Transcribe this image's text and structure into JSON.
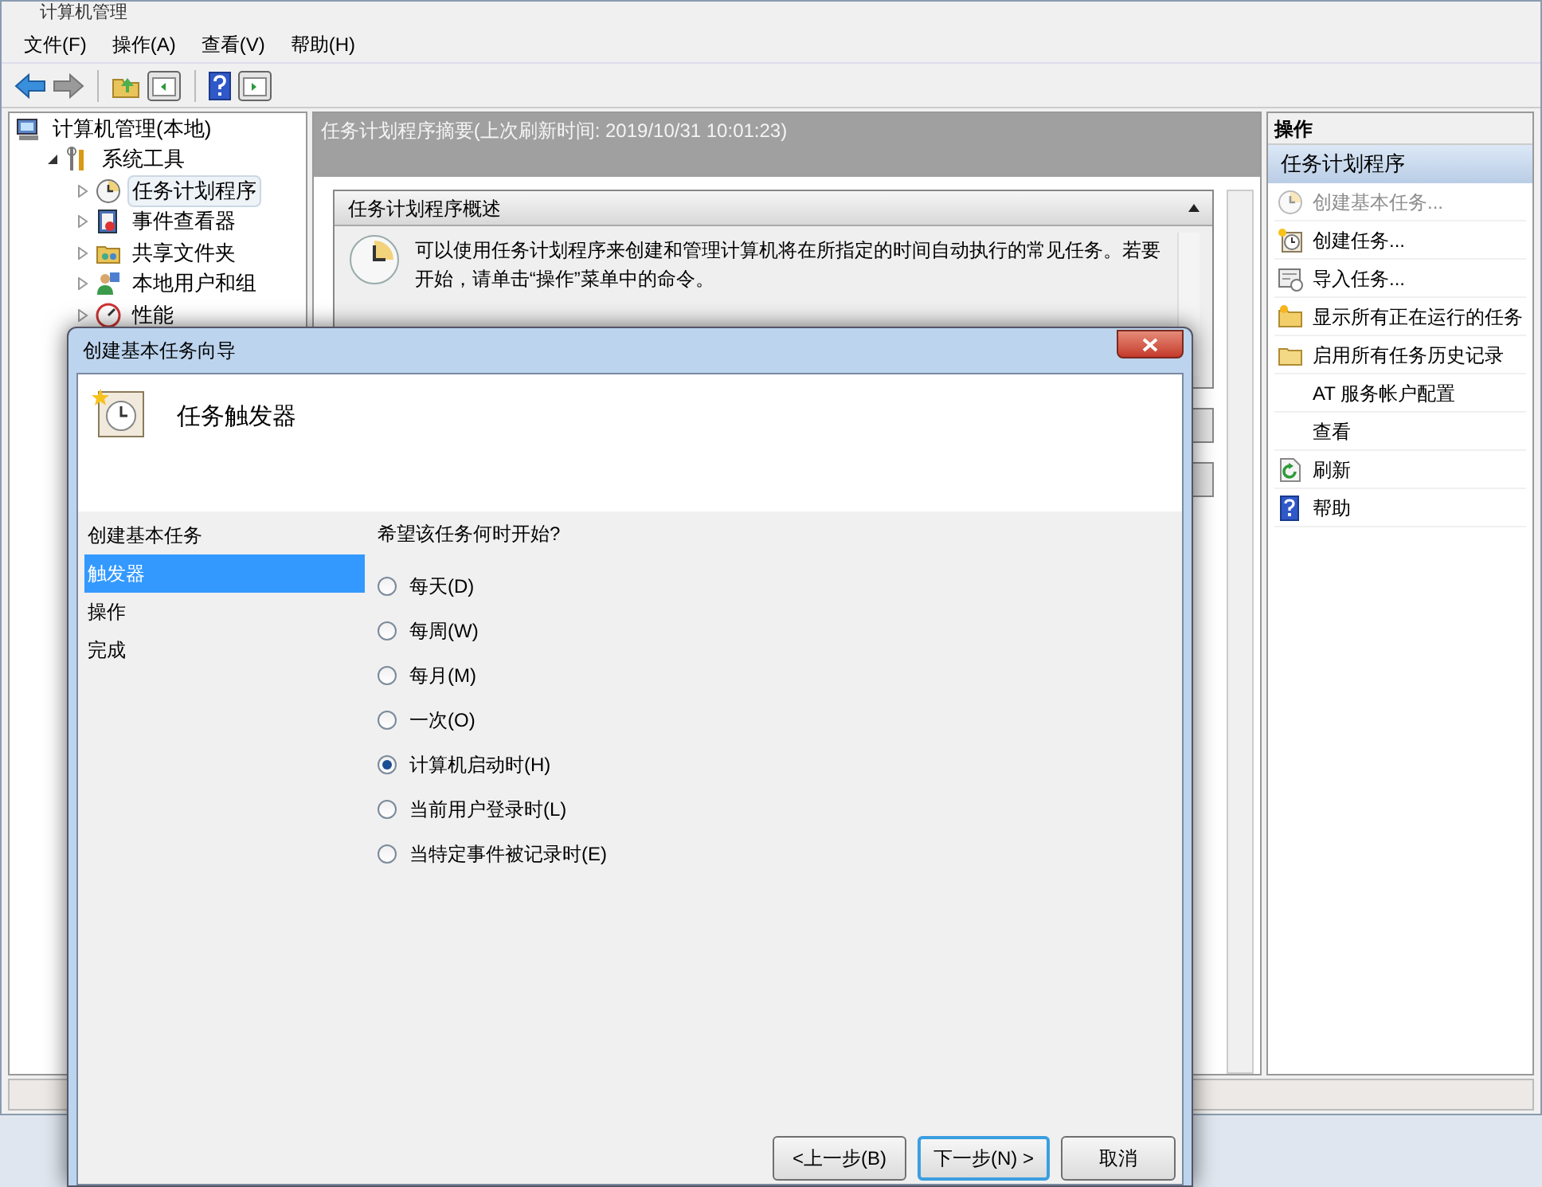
{
  "window": {
    "title": "计算机管理"
  },
  "menu": [
    "文件(F)",
    "操作(A)",
    "查看(V)",
    "帮助(H)"
  ],
  "tree": [
    {
      "label": "计算机管理(本地)",
      "children": [
        {
          "label": "系统工具",
          "expanded": true,
          "children": [
            {
              "label": "任务计划程序",
              "expanded": false,
              "selected": true
            },
            {
              "label": "事件查看器",
              "expanded": false,
              "selected": false
            },
            {
              "label": "共享文件夹",
              "expanded": false,
              "selected": false
            },
            {
              "label": "本地用户和组",
              "expanded": false,
              "selected": false
            },
            {
              "label": "性能",
              "expanded": false,
              "selected": false
            }
          ]
        }
      ]
    }
  ],
  "summary": {
    "header": "任务计划程序摘要(上次刷新时间: 2019/10/31 10:01:23)",
    "section_title": "任务计划程序概述",
    "text": "可以使用任务计划程序来创建和管理计算机将在所指定的时间自动执行的常见任务。若要开始，请单击“操作”菜单中的命令。"
  },
  "actions": {
    "title": "操作",
    "section": "任务计划程序",
    "items": [
      {
        "label": "创建基本任务...",
        "disabled": true
      },
      {
        "label": "创建任务...",
        "disabled": false
      },
      {
        "label": "导入任务...",
        "disabled": false
      },
      {
        "label": "显示所有正在运行的任务",
        "disabled": false
      },
      {
        "label": "启用所有任务历史记录",
        "disabled": false
      },
      {
        "label": "AT 服务帐户配置",
        "disabled": false
      },
      {
        "label": "查看",
        "disabled": false
      },
      {
        "label": "刷新",
        "disabled": false
      },
      {
        "label": "帮助",
        "disabled": false
      }
    ]
  },
  "dialog": {
    "title": "创建基本任务向导",
    "heading": "任务触发器",
    "steps": [
      {
        "label": "创建基本任务",
        "selected": false
      },
      {
        "label": "触发器",
        "selected": true
      },
      {
        "label": "操作",
        "selected": false
      },
      {
        "label": "完成",
        "selected": false
      }
    ],
    "question": "希望该任务何时开始?",
    "options": [
      {
        "label": "每天(D)",
        "selected": false
      },
      {
        "label": "每周(W)",
        "selected": false
      },
      {
        "label": "每月(M)",
        "selected": false
      },
      {
        "label": "一次(O)",
        "selected": false
      },
      {
        "label": "计算机启动时(H)",
        "selected": true
      },
      {
        "label": "当前用户登录时(L)",
        "selected": false
      },
      {
        "label": "当特定事件被记录时(E)",
        "selected": false
      }
    ],
    "buttons": [
      {
        "label": "<上一步(B)",
        "default": false
      },
      {
        "label": "下一步(N) >",
        "default": true
      },
      {
        "label": "取消",
        "default": false
      }
    ]
  }
}
